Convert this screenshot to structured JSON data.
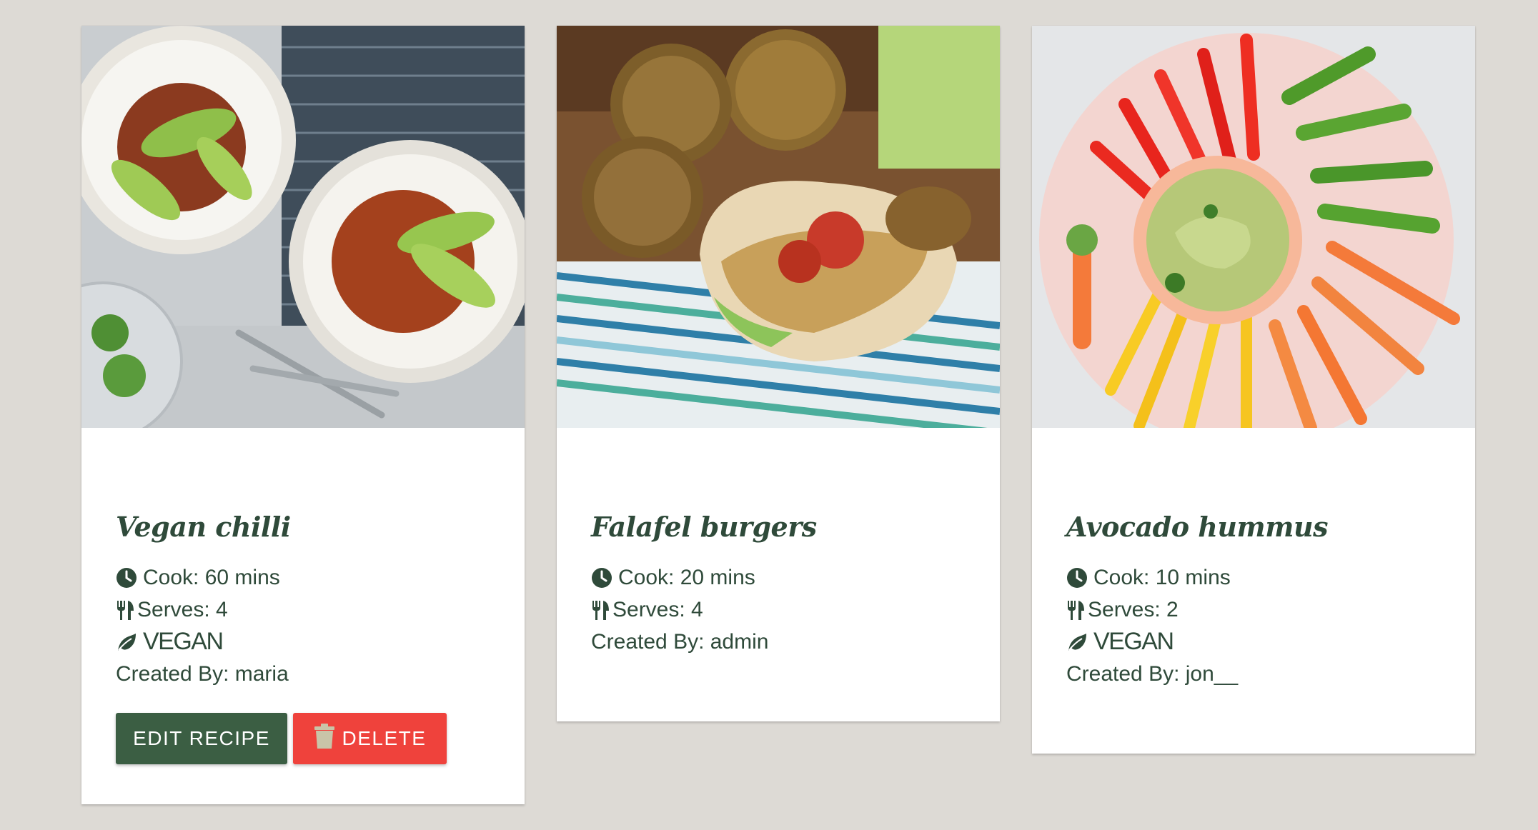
{
  "theme": {
    "background": "#dddad5",
    "card": "#ffffff",
    "text": "#2f4a3a",
    "edit_button": "#3b5e43",
    "delete_button": "#ef423c"
  },
  "recipes": [
    {
      "title": "Vegan chilli",
      "cook": "Cook: 60 mins",
      "serves": "Serves: 4",
      "tag": "VEGAN",
      "created_by": "Created By: maria",
      "image": "vegan-chilli-photo",
      "edit_label": "EDIT RECIPE",
      "delete_label": "DELETE"
    },
    {
      "title": "Falafel burgers",
      "cook": "Cook: 20 mins",
      "serves": "Serves: 4",
      "created_by": "Created By: admin",
      "image": "falafel-burger-photo"
    },
    {
      "title": "Avocado hummus",
      "cook": "Cook: 10 mins",
      "serves": "Serves: 2",
      "tag": "VEGAN",
      "created_by": "Created By: jon__",
      "image": "avocado-hummus-photo"
    }
  ],
  "icons": {
    "cook": "clock-icon",
    "serves": "utensils-icon",
    "vegan": "leaf-icon",
    "delete": "trash-icon"
  }
}
